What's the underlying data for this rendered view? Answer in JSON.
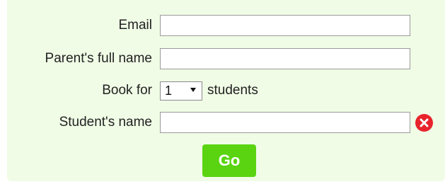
{
  "form": {
    "email": {
      "label": "Email",
      "value": "",
      "placeholder": ""
    },
    "parent_name": {
      "label": "Parent's full name",
      "value": "",
      "placeholder": ""
    },
    "book_for": {
      "label": "Book for",
      "selected": "1",
      "suffix": "students"
    },
    "student_name": {
      "label": "Student's name",
      "value": "",
      "placeholder": "",
      "remove_icon": "remove-x-circle-icon"
    },
    "submit_label": "Go"
  },
  "colors": {
    "panel_background": "#f0fce6",
    "button": "#5ad411",
    "remove_icon": "#e8232c"
  }
}
